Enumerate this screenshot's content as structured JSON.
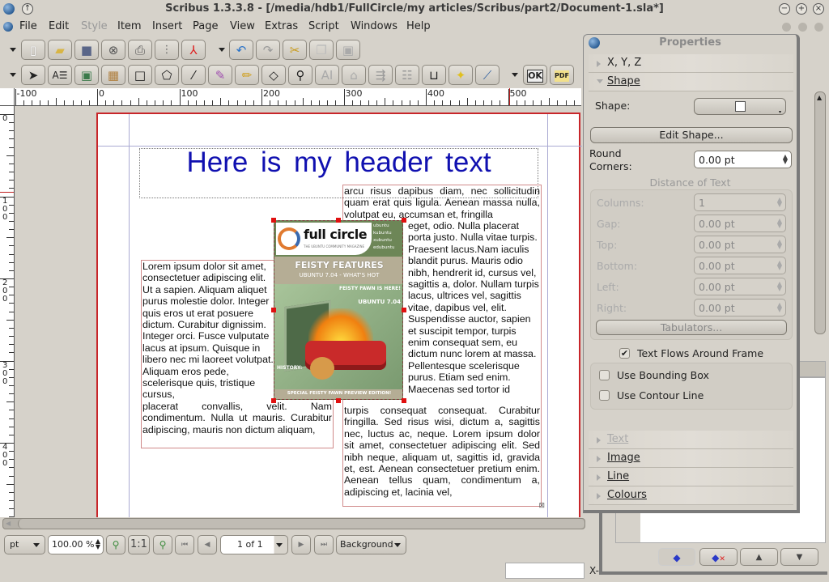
{
  "window": {
    "title": "Scribus 1.3.3.8 - [/media/hdb1/FullCircle/my articles/Scribus/part2/Document-1.sla*]",
    "controls": [
      "minimize",
      "maximize",
      "close"
    ]
  },
  "menu": {
    "items": [
      {
        "label": "File",
        "enabled": true
      },
      {
        "label": "Edit",
        "enabled": true
      },
      {
        "label": "Style",
        "enabled": false
      },
      {
        "label": "Item",
        "enabled": true
      },
      {
        "label": "Insert",
        "enabled": true
      },
      {
        "label": "Page",
        "enabled": true
      },
      {
        "label": "View",
        "enabled": true
      },
      {
        "label": "Extras",
        "enabled": true
      },
      {
        "label": "Script",
        "enabled": true
      },
      {
        "label": "Windows",
        "enabled": true
      },
      {
        "label": "Help",
        "enabled": true
      }
    ]
  },
  "toolbar1": {
    "buttons": [
      "new-document",
      "open",
      "save",
      "close",
      "print",
      "preflight-verifier",
      "export-pdf",
      "undo",
      "redo",
      "cut",
      "copy",
      "paste"
    ]
  },
  "toolbar2": {
    "buttons": [
      "select",
      "text-frame",
      "image-frame",
      "table",
      "shape",
      "polygon",
      "line",
      "bezier",
      "freehand",
      "rotate",
      "zoom",
      "edit-contents",
      "edit-text",
      "link-frames",
      "unlink-frames",
      "measurements",
      "copy-properties",
      "eyedropper",
      "pdf-button",
      "pdf-field"
    ],
    "pdf_button_label": "OK",
    "pdf_field_label": "PDF"
  },
  "rulers": {
    "horizontal_labels": [
      "-100",
      "0",
      "100",
      "200",
      "300",
      "400",
      "500"
    ],
    "vertical_labels": [
      "0",
      "100",
      "200",
      "300",
      "400"
    ]
  },
  "document": {
    "header_text": "Here is my header text",
    "left_text": "Lorem ipsum dolor sit amet, consectetuer adipiscing elit. Ut a sapien. Aliquam aliquet purus molestie dolor. Integer quis eros ut erat posuere dictum. Curabitur dignissim. Integer orci. Fusce vulputate lacus at ipsum. Quisque in libero nec mi laoreet volutpat. Aliquam eros pede, scelerisque quis, tristique cursus, placerat convallis, velit. Nam condimentum. Nulla ut mauris. Curabitur adipiscing, mauris non dictum aliquam,",
    "right_text_top": "arcu risus dapibus diam, nec sollicitudin quam erat quis ligula. Aenean massa nulla, volutpat eu, accumsan et, fringilla",
    "right_text_wrap": "eget, odio. Nulla placerat porta justo. Nulla vitae turpis. Praesent lacus.Nam iaculis blandit purus. Mauris odio nibh, hendrerit id, cursus vel, sagittis a, dolor. Nullam turpis lacus, ultrices vel, sagittis vitae, dapibus vel, elit. Suspendisse auctor, sapien et suscipit tempor, turpis enim consequat sem, eu dictum nunc lorem at massa. Pellentesque scelerisque purus. Etiam sed enim. Maecenas sed tortor id",
    "right_text_bottom": "turpis consequat consequat. Curabitur fringilla. Sed risus wisi, dictum a, sagittis nec, luctus ac, neque. Lorem ipsum dolor sit amet, consectetuer adipiscing elit. Sed nibh neque, aliquam ut, sagittis id, gravida et, est. Aenean consectetuer pretium enim. Aenean tellus quam, condimentum a, adipiscing et, lacinia vel,",
    "image": {
      "magazine_title": "full circle",
      "magazine_tagline": "THE UBUNTU COMMUNITY MAGAZINE",
      "distros": [
        "ubuntu",
        "kubuntu",
        "xubuntu",
        "edubuntu"
      ],
      "headline": "FEISTY FEATURES",
      "subheadline": "UBUNTU 7.04 - WHAT'S HOT",
      "callout": "FEISTY FAWN IS HERE!",
      "callout_sub": "UBUNTU 7.04",
      "side_note": "HISTORY:",
      "footer": "SPECIAL FEISTY FAWN PREVIEW EDITION!"
    }
  },
  "statusbar": {
    "unit": "pt",
    "zoom": "100.00 %",
    "zoom_one_to_one": "1:1",
    "page": "1 of 1",
    "layer": "Background",
    "coord_label": "X-"
  },
  "properties": {
    "title": "Properties",
    "sections": {
      "xyz": "X, Y, Z",
      "shape": "Shape",
      "text": "Text",
      "image": "Image",
      "line": "Line",
      "colours": "Colours"
    },
    "shape_label": "Shape:",
    "edit_shape": "Edit Shape...",
    "round_corners_label": "Round Corners:",
    "round_corners_value": "0.00 pt",
    "distance_of_text": "Distance of Text",
    "fields": [
      {
        "label": "Columns:",
        "value": "1"
      },
      {
        "label": "Gap:",
        "value": "0.00 pt"
      },
      {
        "label": "Top:",
        "value": "0.00 pt"
      },
      {
        "label": "Bottom:",
        "value": "0.00 pt"
      },
      {
        "label": "Left:",
        "value": "0.00 pt"
      },
      {
        "label": "Right:",
        "value": "0.00 pt"
      }
    ],
    "tabulators": "Tabulators...",
    "text_flows": {
      "label": "Text Flows Around Frame",
      "checked": true
    },
    "use_bounding_box": {
      "label": "Use Bounding Box",
      "checked": false
    },
    "use_contour_line": {
      "label": "Use Contour Line",
      "checked": false
    }
  },
  "layers_panel": {
    "buttons": [
      "add-layer",
      "delete-layer",
      "raise-layer",
      "lower-layer"
    ]
  },
  "colors": {
    "page_border": "#c8262a",
    "header_text": "#1010b0",
    "guide": "#a9a9d3",
    "selection_handle": "#e01010"
  }
}
